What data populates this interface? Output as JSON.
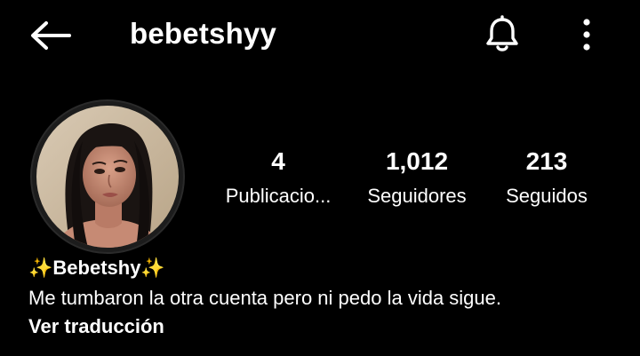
{
  "header": {
    "username": "bebetshyy",
    "back_icon": "arrow-left-icon",
    "notification_icon": "bell-icon",
    "menu_icon": "more-vertical-icon"
  },
  "profile": {
    "avatar_icon": "profile-photo",
    "stats": {
      "posts": {
        "value": "4",
        "label": "Publicacio..."
      },
      "followers": {
        "value": "1,012",
        "label": "Seguidores"
      },
      "following": {
        "value": "213",
        "label": "Seguidos"
      }
    },
    "display_name": "✨Bebetshy✨",
    "bio": "Me tumbaron la otra cuenta pero ni pedo la vida sigue.",
    "translate_link": "Ver traducción"
  },
  "colors": {
    "background": "#000000",
    "text": "#ffffff"
  }
}
